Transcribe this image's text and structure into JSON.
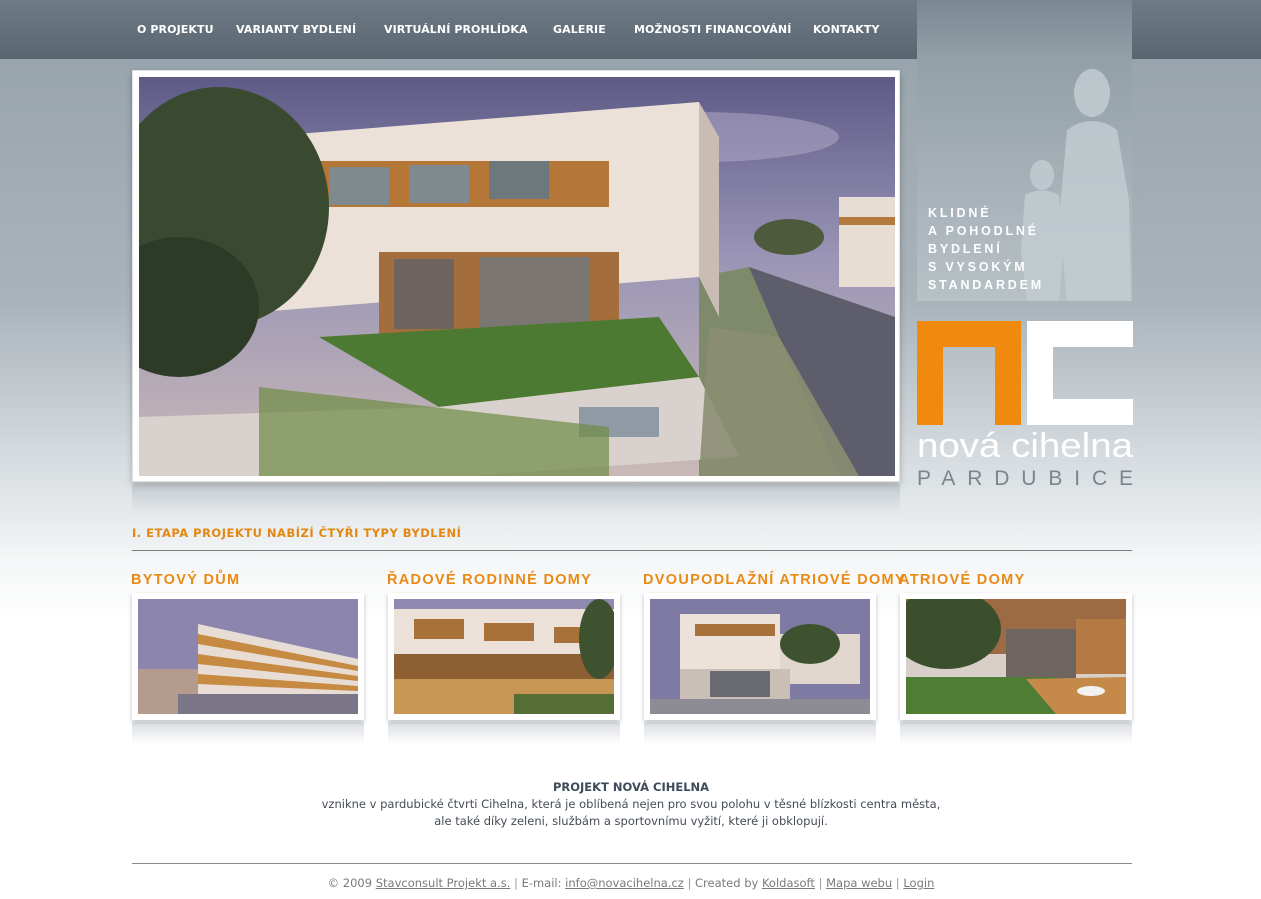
{
  "nav": {
    "items": [
      {
        "label": "O PROJEKTU"
      },
      {
        "label": "VARIANTY BYDLENÍ"
      },
      {
        "label": "VIRTUÁLNÍ PROHLÍDKA"
      },
      {
        "label": "GALERIE"
      },
      {
        "label": "MOŽNOSTI FINANCOVÁNÍ"
      },
      {
        "label": "KONTAKTY"
      }
    ]
  },
  "tagline": [
    "KLIDNÉ",
    "A POHODLNÉ",
    "BYDLENÍ",
    "S VYSOKÝM",
    "STANDARDEM"
  ],
  "logo": {
    "name": "nová cihelna",
    "city": "PARDUBICE",
    "brand_orange": "#ef8a0f"
  },
  "section_title": "I. ETAPA PROJEKTU NABÍZÍ ČTYŘI TYPY BYDLENÍ",
  "housing_types": [
    {
      "title": "BYTOVÝ DŮM"
    },
    {
      "title": "ŘADOVÉ RODINNÉ DOMY"
    },
    {
      "title": "DVOUPODLAŽNÍ ATRIOVÉ DOMY"
    },
    {
      "title": "ATRIOVÉ DOMY"
    }
  ],
  "about": {
    "title": "PROJEKT NOVÁ CIHELNA",
    "line1": "vznikne v pardubické čtvrti Cihelna, která je oblíbená nejen pro svou polohu v těsné blízkosti centra města,",
    "line2": "ale také díky zeleni, službám a sportovnímu vyžití, které ji obklopují."
  },
  "footer": {
    "copyright": "© 2009",
    "company_link": "Stavconsult Projekt a.s.",
    "separator": "|",
    "email_label": "E-mail:",
    "email_link": "info@novacihelna.cz",
    "created_by": "Created by",
    "creator_link": "Koldasoft",
    "sitemap_link": "Mapa webu",
    "login_link": "Login"
  },
  "colors": {
    "accent": "#e48711",
    "nav_bg": "#5f6b75",
    "text": "#454c55"
  }
}
